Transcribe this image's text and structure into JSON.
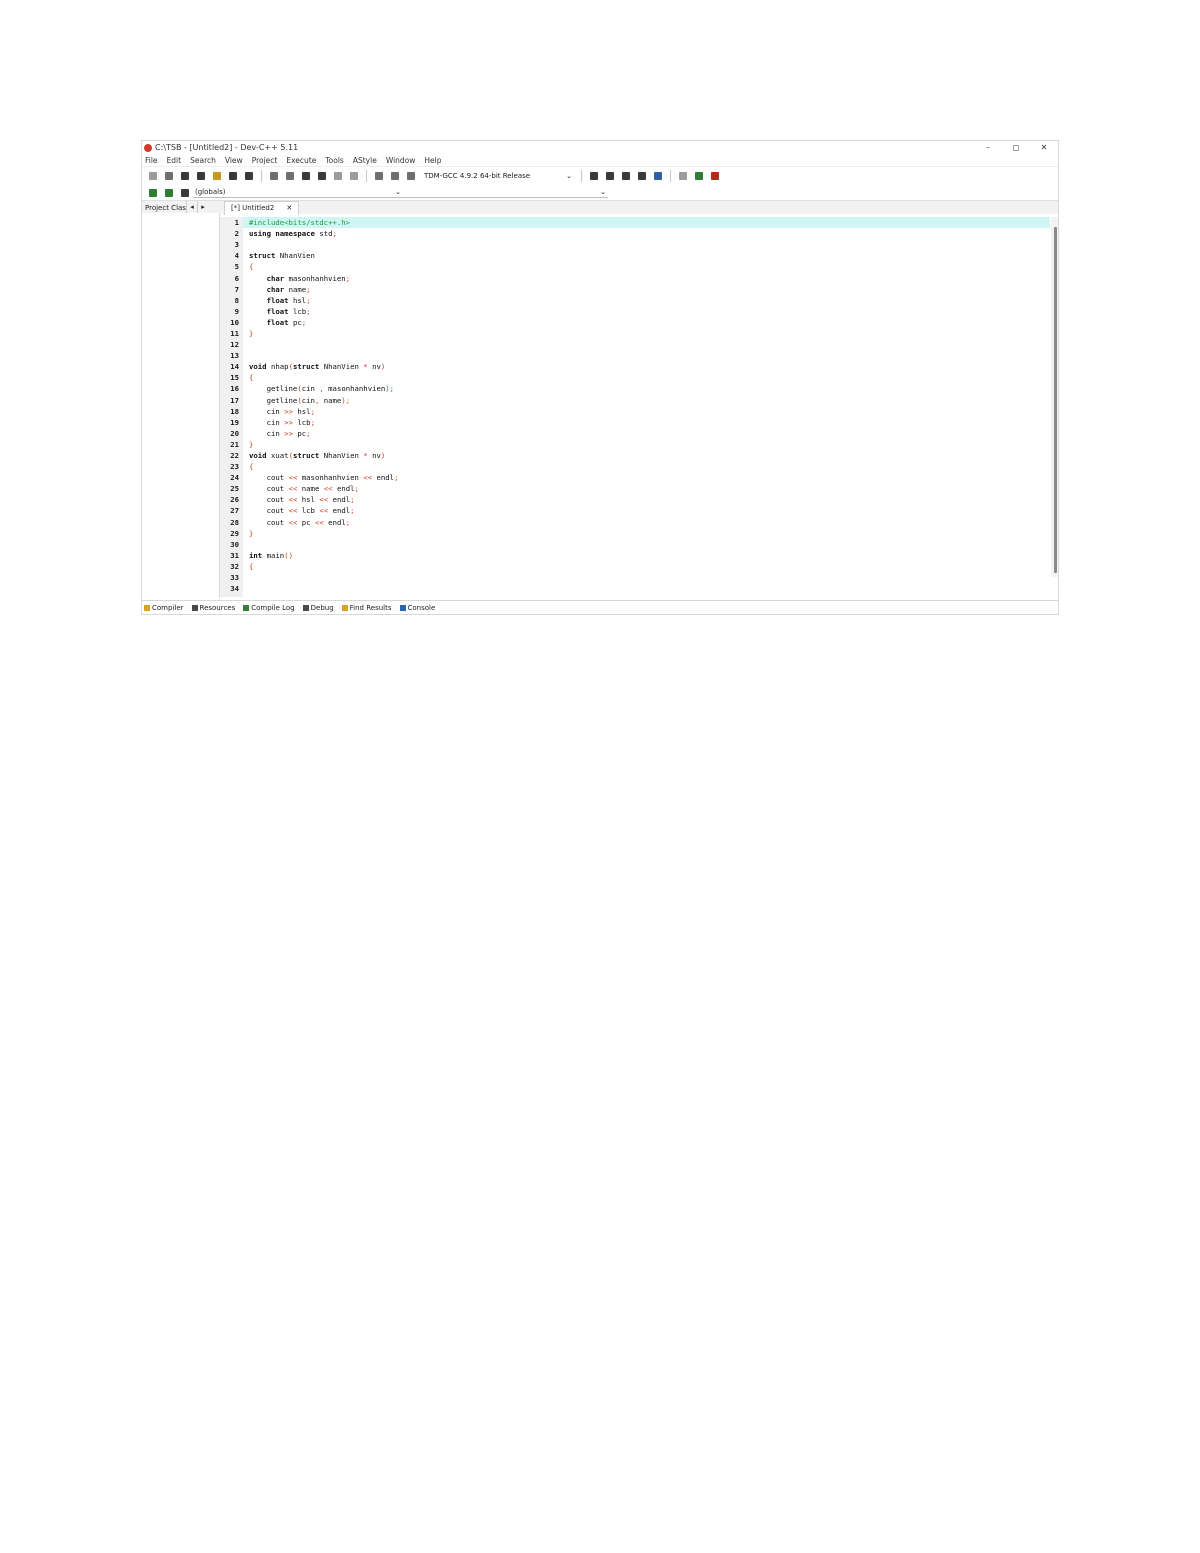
{
  "window": {
    "title": "C:\\TSB - [Untitled2] - Dev-C++ 5.11",
    "controls": [
      "–",
      "◻",
      "✕"
    ]
  },
  "menu": [
    "File",
    "Edit",
    "Search",
    "View",
    "Project",
    "Execute",
    "Tools",
    "AStyle",
    "Window",
    "Help"
  ],
  "toolbar": {
    "compiler": "TDM-GCC 4.9.2 64-bit Release",
    "compiler_arrow": "⌄"
  },
  "toolbar2": {
    "globals": "(globals)",
    "arrow": "⌄"
  },
  "tabs": {
    "project_label": "Project Clas",
    "nav_left": "◂",
    "nav_right": "▸",
    "file_tab": "[*] Untitled2",
    "close": "✕"
  },
  "code": {
    "lines": [
      {
        "n": "1",
        "t": "#include<bits/stdc++.h>"
      },
      {
        "n": "2",
        "t": "using namespace std;"
      },
      {
        "n": "3",
        "t": ""
      },
      {
        "n": "4",
        "t": "struct NhanVien"
      },
      {
        "n": "5",
        "t": "{"
      },
      {
        "n": "6",
        "t": "    char masonhanhvien;"
      },
      {
        "n": "7",
        "t": "    char name;"
      },
      {
        "n": "8",
        "t": "    float hsl;"
      },
      {
        "n": "9",
        "t": "    float lcb;"
      },
      {
        "n": "10",
        "t": "    float pc;"
      },
      {
        "n": "11",
        "t": "}"
      },
      {
        "n": "12",
        "t": ""
      },
      {
        "n": "13",
        "t": ""
      },
      {
        "n": "14",
        "t": "void nhap(struct NhanVien * nv)"
      },
      {
        "n": "15",
        "t": "{"
      },
      {
        "n": "16",
        "t": "    getline(cin , masonhanhvien);"
      },
      {
        "n": "17",
        "t": "    getline(cin, name);"
      },
      {
        "n": "18",
        "t": "    cin >> hsl;"
      },
      {
        "n": "19",
        "t": "    cin >> lcb;"
      },
      {
        "n": "20",
        "t": "    cin >> pc;"
      },
      {
        "n": "21",
        "t": "}"
      },
      {
        "n": "22",
        "t": "void xuat(struct NhanVien * nv)"
      },
      {
        "n": "23",
        "t": "{"
      },
      {
        "n": "24",
        "t": "    cout << masonhanhvien << endl;"
      },
      {
        "n": "25",
        "t": "    cout << name << endl;"
      },
      {
        "n": "26",
        "t": "    cout << hsl << endl;"
      },
      {
        "n": "27",
        "t": "    cout << lcb << endl;"
      },
      {
        "n": "28",
        "t": "    cout << pc << endl;"
      },
      {
        "n": "29",
        "t": "}"
      },
      {
        "n": "30",
        "t": ""
      },
      {
        "n": "31",
        "t": "int main()"
      },
      {
        "n": "32",
        "t": "{"
      },
      {
        "n": "33",
        "t": ""
      },
      {
        "n": "34",
        "t": ""
      }
    ]
  },
  "bottom_tabs": [
    "Compiler",
    "Resources",
    "Compile Log",
    "Debug",
    "Find Results",
    "Console"
  ],
  "colors": {
    "active_line": "#cdf6f4",
    "preprocessor": "#1e9c3b",
    "symbol": "#d23a1f"
  }
}
